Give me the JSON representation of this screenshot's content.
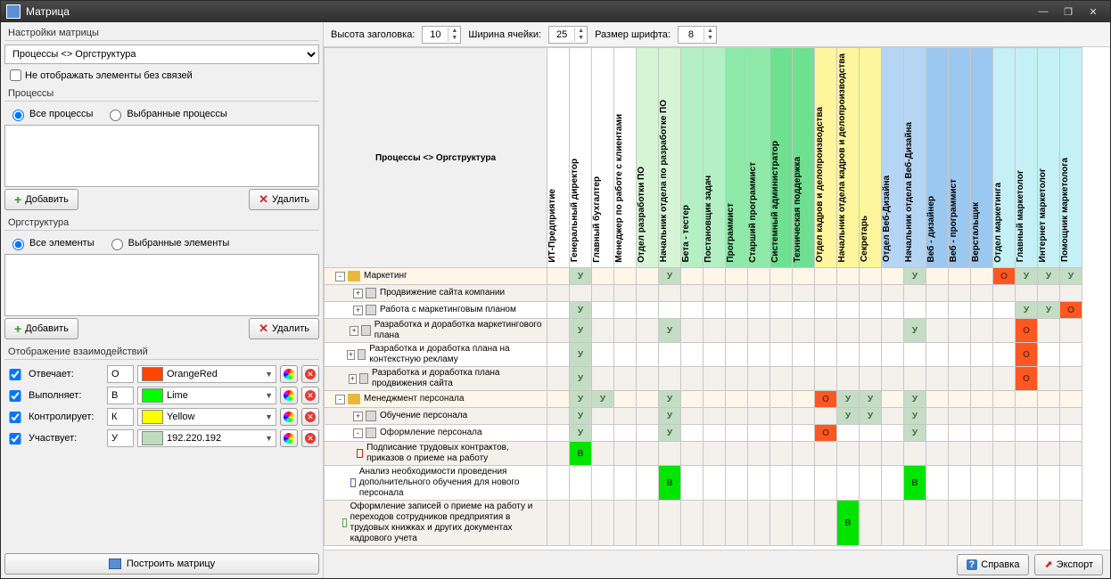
{
  "window": {
    "title": "Матрица"
  },
  "left": {
    "settings_label": "Настройки матрицы",
    "matrix_type": "Процессы <> Оргструктура",
    "no_links_label": "Не отображать элементы без связей",
    "processes_label": "Процессы",
    "all_processes": "Все процессы",
    "selected_processes": "Выбранные процессы",
    "add": "Добавить",
    "del": "Удалить",
    "org_label": "Оргструктура",
    "all_elements": "Все элементы",
    "selected_elements": "Выбранные элементы",
    "interactions_label": "Отображение взаимодействий",
    "roles": [
      {
        "label": "Отвечает:",
        "code": "О",
        "color_name": "OrangeRed",
        "color": "#ff4500"
      },
      {
        "label": "Выполняет:",
        "code": "В",
        "color_name": "Lime",
        "color": "#00ff00"
      },
      {
        "label": "Контролирует:",
        "code": "К",
        "color_name": "Yellow",
        "color": "#ffff00"
      },
      {
        "label": "Участвует:",
        "code": "У",
        "color_name": "192.220.192",
        "color": "#c0dcc0"
      }
    ],
    "build": "Построить матрицу"
  },
  "toolbar": {
    "header_h_label": "Высота заголовка:",
    "header_h": "10",
    "cell_w_label": "Ширина ячейки:",
    "cell_w": "25",
    "font_label": "Размер шрифта:",
    "font": "8"
  },
  "matrix": {
    "corner": "Процессы <> Оргструктура",
    "columns": [
      {
        "label": "ИТ-Предприятие",
        "bg": "bg-white"
      },
      {
        "label": "Генеральный директор",
        "bg": "bg-white"
      },
      {
        "label": "Главный бухгалтер",
        "bg": "bg-white"
      },
      {
        "label": "Менеджер по работе с клиентами",
        "bg": "bg-white"
      },
      {
        "label": "Отдел разработки ПО",
        "bg": "bg-lg1"
      },
      {
        "label": "Начальник отдела по разработке ПО",
        "bg": "bg-lg1"
      },
      {
        "label": "Бета - тестер",
        "bg": "bg-lg2"
      },
      {
        "label": "Постановщик задач",
        "bg": "bg-lg2"
      },
      {
        "label": "Программист",
        "bg": "bg-lg3"
      },
      {
        "label": "Старший программист",
        "bg": "bg-lg3"
      },
      {
        "label": "Системный администратор",
        "bg": "bg-lg4"
      },
      {
        "label": "Техническая поддержка",
        "bg": "bg-lg4"
      },
      {
        "label": "Отдел кадров и делопроизводства",
        "bg": "bg-yel"
      },
      {
        "label": "Начальник отдела кадров и делопроизводства",
        "bg": "bg-yel"
      },
      {
        "label": "Секретарь",
        "bg": "bg-yel"
      },
      {
        "label": "Отдел Веб-Дизайна",
        "bg": "bg-blue1"
      },
      {
        "label": "Начальник отдела Веб-Дизайна",
        "bg": "bg-blue1"
      },
      {
        "label": "Веб - дизайнер",
        "bg": "bg-blue2"
      },
      {
        "label": "Веб - программист",
        "bg": "bg-blue2"
      },
      {
        "label": "Верстальщик",
        "bg": "bg-blue2"
      },
      {
        "label": "Отдел маркетинга",
        "bg": "bg-cyan"
      },
      {
        "label": "Главный маркетолог",
        "bg": "bg-cyan"
      },
      {
        "label": "Интернет маркетолог",
        "bg": "bg-cyan"
      },
      {
        "label": "Помощник маркетолога",
        "bg": "bg-cyan"
      }
    ],
    "rows": [
      {
        "level": 0,
        "exp": "-",
        "icon": "folder",
        "label": "Маркетинг",
        "group": true,
        "cells": {
          "1": "У",
          "5": "У",
          "16": "У",
          "20": "О",
          "21": "У",
          "22": "У",
          "23": "У"
        }
      },
      {
        "level": 1,
        "exp": "+",
        "icon": "proc",
        "label": "Продвижение сайта компании",
        "cells": {}
      },
      {
        "level": 1,
        "exp": "+",
        "icon": "proc",
        "label": "Работа с маркетинговым планом",
        "cells": {
          "1": "У",
          "21": "У",
          "22": "У",
          "23": "О"
        }
      },
      {
        "level": 1,
        "exp": "+",
        "icon": "proc",
        "label": "Разработка и доработка маркетингового плана",
        "cells": {
          "1": "У",
          "5": "У",
          "16": "У",
          "21": "О"
        }
      },
      {
        "level": 1,
        "exp": "+",
        "icon": "proc",
        "label": "Разработка и доработка плана на контекстную рекламу",
        "cells": {
          "1": "У",
          "21": "О"
        }
      },
      {
        "level": 1,
        "exp": "+",
        "icon": "proc",
        "label": "Разработка и доработка плана продвижения сайта",
        "cells": {
          "1": "У",
          "21": "О"
        }
      },
      {
        "level": 0,
        "exp": "-",
        "icon": "folder",
        "label": "Менеджмент персонала",
        "group": true,
        "cells": {
          "1": "У",
          "2": "У",
          "5": "У",
          "12": "О",
          "13": "У",
          "14": "У",
          "16": "У"
        }
      },
      {
        "level": 1,
        "exp": "+",
        "icon": "proc",
        "label": "Обучение персонала",
        "cells": {
          "1": "У",
          "5": "У",
          "13": "У",
          "14": "У",
          "16": "У"
        }
      },
      {
        "level": 1,
        "exp": "-",
        "icon": "proc",
        "label": "Оформление персонала",
        "cells": {
          "1": "У",
          "5": "У",
          "12": "О",
          "16": "У"
        }
      },
      {
        "level": 2,
        "icon": "func",
        "func_color": "#c62828",
        "label": "Подписание трудовых контрактов, приказов о приеме на работу",
        "cells": {
          "1": "В"
        }
      },
      {
        "level": 2,
        "icon": "func",
        "func_color": "#4a6aaa",
        "label": "Анализ необходимости проведения дополнительного обучения для нового персонала",
        "cells": {
          "5": "В",
          "16": "В"
        }
      },
      {
        "level": 2,
        "icon": "func",
        "func_color": "#5aaa5a",
        "label": "Оформление записей о приеме на работу и переходов сотрудников предприятия в трудовых книжках и других документах кадрового учета",
        "cells": {
          "13": "В"
        }
      }
    ]
  },
  "footer": {
    "help": "Справка",
    "export": "Экспорт"
  }
}
